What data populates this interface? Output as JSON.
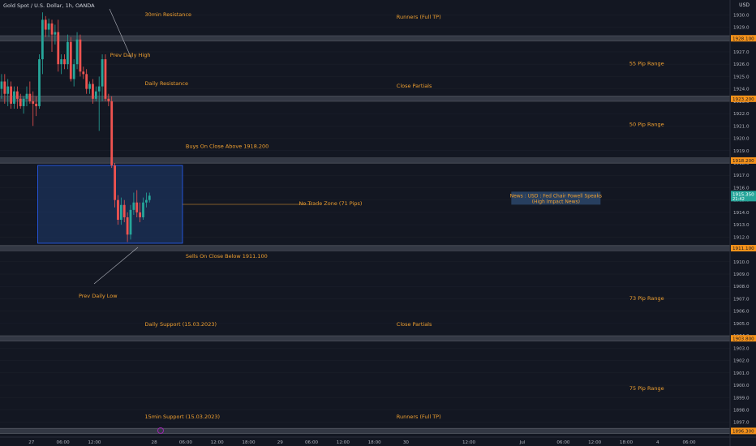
{
  "window": {
    "symbol_title": "Gold Spot / U.S. Dollar, 1h, OANDA",
    "currency": "USD"
  },
  "colors": {
    "background": "#131722",
    "up": "#26a69a",
    "down": "#ef5350",
    "annotation": "#f0a030",
    "level_band": "#3a3e4a",
    "zone_fill": "#1e3a6e",
    "zone_border": "#2962ff",
    "price_tag_orange": "#f7931a",
    "price_tag_teal": "#26a69a",
    "axis_text": "#b2b5be",
    "grid": "#1e222d"
  },
  "chart_data": {
    "type": "candlestick",
    "symbol": "XAUUSD",
    "timeframe": "1h",
    "ylim": [
      1895.8,
      1931.2
    ],
    "yticks": [
      1897.0,
      1898.0,
      1899.0,
      1900.0,
      1901.0,
      1902.0,
      1903.0,
      1904.0,
      1905.0,
      1906.0,
      1907.0,
      1908.0,
      1909.0,
      1910.0,
      1911.0,
      1912.0,
      1913.0,
      1914.0,
      1915.0,
      1916.0,
      1917.0,
      1918.0,
      1919.0,
      1920.0,
      1921.0,
      1922.0,
      1923.0,
      1924.0,
      1925.0,
      1926.0,
      1927.0,
      1928.0,
      1929.0,
      1930.0
    ],
    "xlim": [
      0,
      232
    ],
    "xticks": [
      {
        "t": 10,
        "label": "27"
      },
      {
        "t": 20,
        "label": "06:00"
      },
      {
        "t": 30,
        "label": "12:00"
      },
      {
        "t": 49,
        "label": "28"
      },
      {
        "t": 59,
        "label": "06:00"
      },
      {
        "t": 69,
        "label": "12:00"
      },
      {
        "t": 79,
        "label": "18:00"
      },
      {
        "t": 89,
        "label": "29"
      },
      {
        "t": 99,
        "label": "06:00"
      },
      {
        "t": 109,
        "label": "12:00"
      },
      {
        "t": 119,
        "label": "18:00"
      },
      {
        "t": 129,
        "label": "30"
      },
      {
        "t": 149,
        "label": "12:00"
      },
      {
        "t": 166,
        "label": "Jul"
      },
      {
        "t": 179,
        "label": "06:00"
      },
      {
        "t": 189,
        "label": "12:00"
      },
      {
        "t": 199,
        "label": "18:00"
      },
      {
        "t": 209,
        "label": "4"
      },
      {
        "t": 219,
        "label": "06:00"
      }
    ],
    "candles": [
      {
        "t": 0,
        "o": 1924.0,
        "h": 1925.2,
        "l": 1923.2,
        "c": 1924.6
      },
      {
        "t": 1,
        "o": 1924.6,
        "h": 1925.2,
        "l": 1922.8,
        "c": 1923.6
      },
      {
        "t": 2,
        "o": 1923.6,
        "h": 1924.8,
        "l": 1922.6,
        "c": 1924.2
      },
      {
        "t": 3,
        "o": 1924.2,
        "h": 1924.6,
        "l": 1922.4,
        "c": 1922.8
      },
      {
        "t": 4,
        "o": 1922.8,
        "h": 1924.2,
        "l": 1922.4,
        "c": 1923.8
      },
      {
        "t": 5,
        "o": 1923.8,
        "h": 1924.2,
        "l": 1922.4,
        "c": 1923.2
      },
      {
        "t": 6,
        "o": 1923.2,
        "h": 1923.6,
        "l": 1922.4,
        "c": 1922.6
      },
      {
        "t": 7,
        "o": 1922.6,
        "h": 1923.4,
        "l": 1922.0,
        "c": 1923.2
      },
      {
        "t": 8,
        "o": 1923.2,
        "h": 1924.2,
        "l": 1922.6,
        "c": 1923.6
      },
      {
        "t": 9,
        "o": 1923.6,
        "h": 1924.6,
        "l": 1922.8,
        "c": 1923.0
      },
      {
        "t": 10,
        "o": 1923.0,
        "h": 1923.8,
        "l": 1921.0,
        "c": 1922.8
      },
      {
        "t": 11,
        "o": 1922.8,
        "h": 1923.4,
        "l": 1921.8,
        "c": 1922.6
      },
      {
        "t": 12,
        "o": 1922.6,
        "h": 1926.8,
        "l": 1922.4,
        "c": 1926.4
      },
      {
        "t": 13,
        "o": 1926.4,
        "h": 1930.2,
        "l": 1925.2,
        "c": 1929.6
      },
      {
        "t": 14,
        "o": 1929.6,
        "h": 1929.9,
        "l": 1928.2,
        "c": 1928.8
      },
      {
        "t": 15,
        "o": 1928.8,
        "h": 1929.7,
        "l": 1928.2,
        "c": 1929.3
      },
      {
        "t": 16,
        "o": 1929.3,
        "h": 1929.6,
        "l": 1927.0,
        "c": 1928.4
      },
      {
        "t": 17,
        "o": 1928.4,
        "h": 1929.2,
        "l": 1927.6,
        "c": 1928.6
      },
      {
        "t": 18,
        "o": 1928.6,
        "h": 1929.6,
        "l": 1925.4,
        "c": 1926.0
      },
      {
        "t": 19,
        "o": 1926.0,
        "h": 1926.8,
        "l": 1925.2,
        "c": 1926.4
      },
      {
        "t": 20,
        "o": 1926.4,
        "h": 1926.8,
        "l": 1925.6,
        "c": 1926.0
      },
      {
        "t": 21,
        "o": 1926.0,
        "h": 1928.4,
        "l": 1925.6,
        "c": 1927.8
      },
      {
        "t": 22,
        "o": 1927.8,
        "h": 1928.2,
        "l": 1924.6,
        "c": 1924.8
      },
      {
        "t": 23,
        "o": 1924.8,
        "h": 1926.4,
        "l": 1924.2,
        "c": 1926.0
      },
      {
        "t": 24,
        "o": 1926.0,
        "h": 1928.6,
        "l": 1925.6,
        "c": 1928.0
      },
      {
        "t": 25,
        "o": 1928.0,
        "h": 1928.4,
        "l": 1925.0,
        "c": 1925.4
      },
      {
        "t": 26,
        "o": 1925.4,
        "h": 1925.8,
        "l": 1924.8,
        "c": 1925.2
      },
      {
        "t": 27,
        "o": 1925.2,
        "h": 1925.6,
        "l": 1923.6,
        "c": 1924.0
      },
      {
        "t": 28,
        "o": 1924.0,
        "h": 1924.6,
        "l": 1923.6,
        "c": 1924.4
      },
      {
        "t": 29,
        "o": 1924.4,
        "h": 1924.8,
        "l": 1922.8,
        "c": 1923.2
      },
      {
        "t": 30,
        "o": 1923.2,
        "h": 1924.2,
        "l": 1923.0,
        "c": 1923.8
      },
      {
        "t": 31,
        "o": 1923.8,
        "h": 1925.0,
        "l": 1920.6,
        "c": 1924.2
      },
      {
        "t": 32,
        "o": 1924.2,
        "h": 1926.8,
        "l": 1923.0,
        "c": 1926.4
      },
      {
        "t": 33,
        "o": 1926.4,
        "h": 1926.8,
        "l": 1923.0,
        "c": 1923.2
      },
      {
        "t": 34,
        "o": 1923.2,
        "h": 1923.6,
        "l": 1922.6,
        "c": 1923.0
      },
      {
        "t": 35,
        "o": 1923.0,
        "h": 1923.4,
        "l": 1917.6,
        "c": 1917.8
      },
      {
        "t": 36,
        "o": 1917.8,
        "h": 1918.0,
        "l": 1914.4,
        "c": 1915.0
      },
      {
        "t": 37,
        "o": 1915.0,
        "h": 1915.4,
        "l": 1913.0,
        "c": 1913.4
      },
      {
        "t": 38,
        "o": 1913.4,
        "h": 1915.2,
        "l": 1913.0,
        "c": 1914.6
      },
      {
        "t": 39,
        "o": 1914.6,
        "h": 1915.0,
        "l": 1913.2,
        "c": 1913.6
      },
      {
        "t": 40,
        "o": 1913.6,
        "h": 1914.0,
        "l": 1911.6,
        "c": 1912.2
      },
      {
        "t": 41,
        "o": 1912.2,
        "h": 1914.6,
        "l": 1911.8,
        "c": 1914.2
      },
      {
        "t": 42,
        "o": 1914.2,
        "h": 1915.6,
        "l": 1913.8,
        "c": 1914.8
      },
      {
        "t": 43,
        "o": 1914.8,
        "h": 1915.8,
        "l": 1913.6,
        "c": 1914.0
      },
      {
        "t": 44,
        "o": 1914.0,
        "h": 1914.8,
        "l": 1913.2,
        "c": 1913.6
      },
      {
        "t": 45,
        "o": 1913.6,
        "h": 1915.2,
        "l": 1913.4,
        "c": 1914.8
      },
      {
        "t": 46,
        "o": 1914.8,
        "h": 1915.6,
        "l": 1914.4,
        "c": 1915.0
      },
      {
        "t": 47,
        "o": 1915.0,
        "h": 1915.6,
        "l": 1914.8,
        "c": 1915.35
      }
    ],
    "levels": [
      {
        "price": 1928.1,
        "tag": "1928.100"
      },
      {
        "price": 1923.2,
        "tag": "1923.200"
      },
      {
        "price": 1918.2,
        "tag": "1918.200"
      },
      {
        "price": 1911.1,
        "tag": "1911.100"
      },
      {
        "price": 1903.8,
        "tag": "1903.800"
      },
      {
        "price": 1896.3,
        "tag": "1896.300"
      }
    ],
    "current_price": {
      "value": 1915.35,
      "label": "1915.350",
      "countdown": "21:42"
    },
    "no_trade_zone": {
      "t0": 12,
      "t1": 58,
      "p_top": 1917.8,
      "p_bottom": 1911.5
    },
    "annotations": [
      {
        "text": "30min Resistance",
        "t": 46,
        "p": 1929.9
      },
      {
        "text": "Runners (Full TP)",
        "t": 126,
        "p": 1929.7
      },
      {
        "text": "Prev Daily High",
        "t": 35,
        "p": 1926.6
      },
      {
        "text": "55 Pip Range",
        "t": 200,
        "p": 1925.9
      },
      {
        "text": "Daily Resistance",
        "t": 46,
        "p": 1924.3
      },
      {
        "text": "Close Partials",
        "t": 126,
        "p": 1924.1
      },
      {
        "text": "50 Pip Range",
        "t": 200,
        "p": 1921.0
      },
      {
        "text": "Buys On Close Above 1918.200",
        "t": 59,
        "p": 1919.2
      },
      {
        "text": "No Trade Zone (71 Pips)",
        "t": 95,
        "p": 1914.6
      },
      {
        "text": "Sells On Close Below 1911.100",
        "t": 59,
        "p": 1910.3
      },
      {
        "text": "Prev Daily Low",
        "t": 25,
        "p": 1907.1
      },
      {
        "text": "73 Pip Range",
        "t": 200,
        "p": 1906.9
      },
      {
        "text": "Daily Support (15.03.2023)",
        "t": 46,
        "p": 1904.8
      },
      {
        "text": "Close Partials",
        "t": 126,
        "p": 1904.8
      },
      {
        "text": "75 Pip Range",
        "t": 200,
        "p": 1899.6
      },
      {
        "text": "15min Support (15.03.2023)",
        "t": 46,
        "p": 1897.3
      },
      {
        "text": "Runners (Full TP)",
        "t": 126,
        "p": 1897.3
      }
    ],
    "news": {
      "line1": "News : USD : Fed Chair Powell Speaks",
      "line2": "(High Impact News)",
      "t": 163,
      "p": 1915.15
    }
  }
}
